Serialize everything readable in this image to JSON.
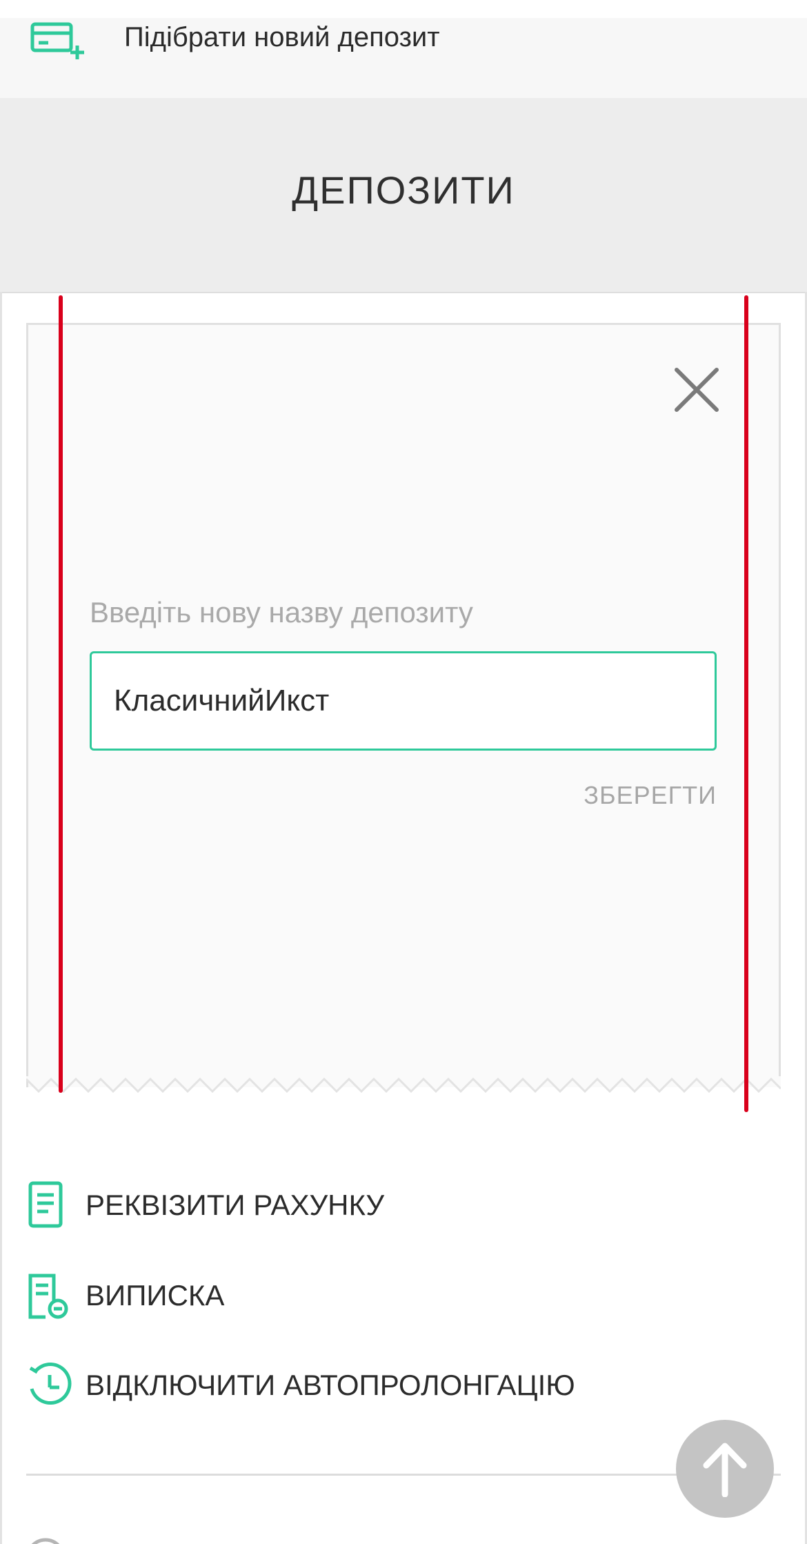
{
  "new_deposit": {
    "label": "Підібрати новий депозит",
    "icon": "card-plus-icon"
  },
  "section": {
    "title": "ДЕПОЗИТИ"
  },
  "rename_form": {
    "label": "Введіть нову назву депозиту",
    "input_value": "КласичнийИкст",
    "save_label": "ЗБЕРЕГТИ",
    "close_icon": "close-icon"
  },
  "menu": {
    "items": [
      {
        "label": "РЕКВІЗИТИ РАХУНКУ",
        "icon": "document-icon"
      },
      {
        "label": "ВИПИСКА",
        "icon": "statement-icon"
      },
      {
        "label": "ВІДКЛЮЧИТИ АВТОПРОЛОНГАЦІЮ",
        "icon": "history-clock-icon"
      }
    ]
  },
  "scroll_top": {
    "icon": "arrow-up-icon"
  },
  "colors": {
    "accent": "#2ec99a",
    "marker": "#d9001b",
    "header_bg": "#ededed",
    "fab_bg": "#c4c4c4"
  }
}
